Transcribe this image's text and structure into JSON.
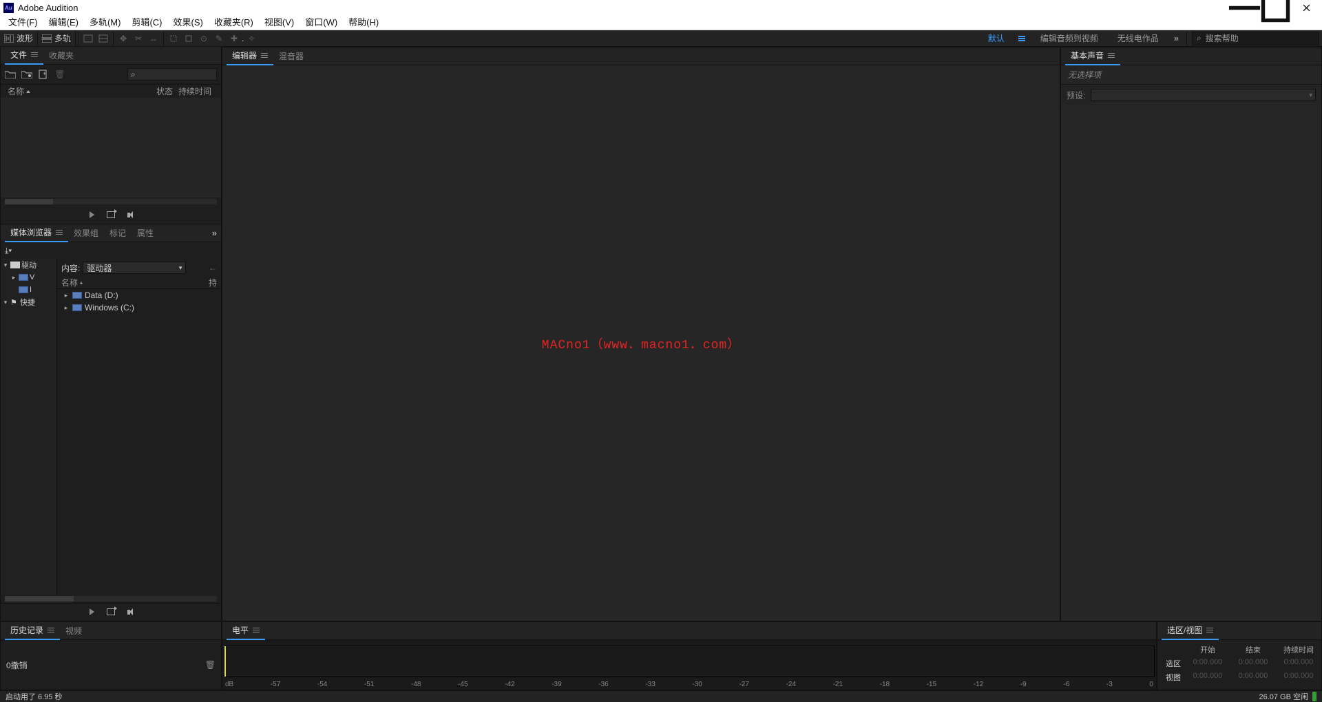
{
  "app": {
    "title": "Adobe Audition"
  },
  "menubar": [
    "文件(F)",
    "编辑(E)",
    "多轨(M)",
    "剪辑(C)",
    "效果(S)",
    "收藏夹(R)",
    "视图(V)",
    "窗口(W)",
    "帮助(H)"
  ],
  "toolbar": {
    "waveform_label": "波形",
    "multitrack_label": "多轨",
    "workspaces": {
      "default": "默认",
      "edit_video": "编辑音频到视频",
      "radio": "无线电作品"
    },
    "search_placeholder": "搜索帮助"
  },
  "files_panel": {
    "tabs": {
      "files": "文件",
      "favorites": "收藏夹"
    },
    "columns": {
      "name": "名称",
      "status": "状态",
      "duration": "持续时间"
    }
  },
  "media_browser": {
    "tabs": {
      "media": "媒体浏览器",
      "effects": "效果组",
      "markers": "标记",
      "properties": "属性"
    },
    "content_label": "内容:",
    "dropdown_value": "驱动器",
    "tree": {
      "drives": "驱动",
      "v_drive": "V",
      "i_drive": "I",
      "shortcuts": "快捷"
    },
    "list": {
      "col_name": "名称",
      "col_dur": "持",
      "rows": [
        {
          "name": "Data (D:)"
        },
        {
          "name": "Windows (C:)"
        }
      ]
    }
  },
  "editor_panel": {
    "tabs": {
      "editor": "编辑器",
      "mixer": "混音器"
    },
    "watermark": "MACno1（www．macno1．com）"
  },
  "essential_sound": {
    "tab": "基本声音",
    "no_selection": "无选择项",
    "preset_label": "预设:"
  },
  "history_panel": {
    "tabs": {
      "history": "历史记录",
      "video": "视频"
    },
    "undo_text": "0撤销"
  },
  "level_panel": {
    "tab": "电平",
    "scale": [
      "dB",
      "-57",
      "-54",
      "-51",
      "-48",
      "-45",
      "-42",
      "-39",
      "-36",
      "-33",
      "-30",
      "-27",
      "-24",
      "-21",
      "-18",
      "-15",
      "-12",
      "-9",
      "-6",
      "-3",
      "0"
    ]
  },
  "selection_panel": {
    "tab": "选区/视图",
    "cols": {
      "start": "开始",
      "end": "结束",
      "duration": "持续时间"
    },
    "rows": {
      "selection": {
        "label": "选区",
        "start": "0:00.000",
        "end": "0:00.000",
        "duration": "0:00.000"
      },
      "view": {
        "label": "视图",
        "start": "0:00.000",
        "end": "0:00.000",
        "duration": "0:00.000"
      }
    }
  },
  "statusbar": {
    "left": "启动用了 6.95 秒",
    "right": "26.07 GB 空闲"
  }
}
